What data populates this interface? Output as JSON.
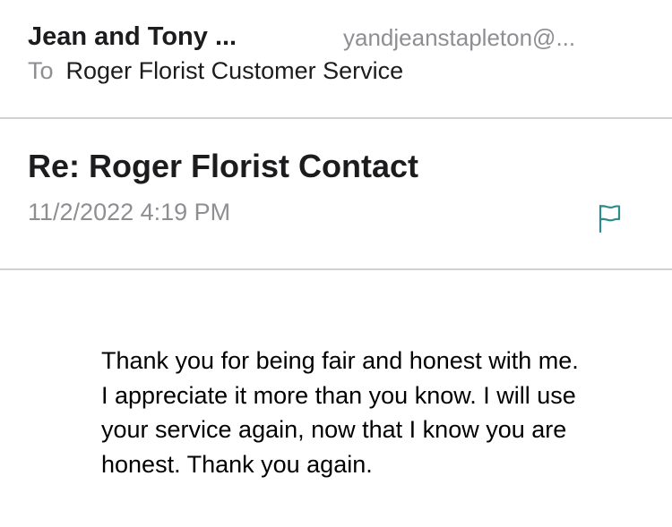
{
  "message": {
    "sender_name": "Jean and Tony ...",
    "sender_email": "yandjeanstapleton@...",
    "to_label": "To",
    "to_value": "Roger Florist Customer Service",
    "subject": "Re: Roger Florist Contact",
    "date": "11/2/2022 4:19 PM",
    "body": "Thank you for being fair and honest with me. I appreciate it more than you know. I will use your service again, now that I know you are honest. Thank you again."
  },
  "icons": {
    "flag": "flag-icon"
  },
  "colors": {
    "accent": "#2e8b8b",
    "secondary_text": "#8e8e93",
    "divider": "#d1d1d6"
  }
}
